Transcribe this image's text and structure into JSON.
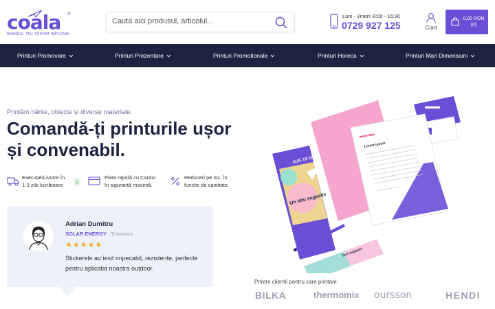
{
  "brand": {
    "name": "coala",
    "registered": "®",
    "tagline": "BRANDUL TĂU, PRINTAT IMPECABIL",
    "accent": "#6a4fd6",
    "dark": "#1d2340"
  },
  "search": {
    "placeholder": "Cauta aici produsul, articolul..."
  },
  "contact": {
    "hours": "Luni - Vineri: 8:00 - 16:30",
    "phone": "0729 927 125"
  },
  "account": {
    "label": "Cont"
  },
  "cart": {
    "total": "0,00 RON",
    "count": "(0)"
  },
  "nav": {
    "items": [
      {
        "label": "Printuri Promovare"
      },
      {
        "label": "Printuri Prezentare"
      },
      {
        "label": "Printuri Promotionale"
      },
      {
        "label": "Printuri Horeca"
      },
      {
        "label": "Printuri Mari Dimensiuni"
      }
    ]
  },
  "hero": {
    "subtitle": "Printăm hârtie, obiecte și diverse materiale.",
    "title": "Comandă-ți printurile ușor și convenabil."
  },
  "features": [
    {
      "icon": "truck-icon",
      "line1": "Execuție/Livrare în",
      "line2": "1-3 zile lucrătoare"
    },
    {
      "icon": "card-icon",
      "line1": "Plata rapidă cu Cardul",
      "line2": "în siguranță maximă."
    },
    {
      "icon": "percent-icon",
      "line1": "Reduceri pe loc, în",
      "line2": "funcție de cantitate."
    }
  ],
  "review": {
    "name": "Adrian Dumitru",
    "company": "SOLAR ENERGY",
    "city": "Timisoara",
    "stars": "★★★★★",
    "rating": 5,
    "text": "Stickerele au iesit impecabil, rezistente, perfecte pentru aplicatia noastra outdoor."
  },
  "mockup": {
    "brochure_title": "Un titlu sugestiv",
    "brochure_date": "AUG 10-12",
    "letter_heading": "Lorem ipsum",
    "card_text": "Text sugestiv"
  },
  "clients": {
    "label": "Printre clientii pentru care printam",
    "logos": [
      "BILKA",
      "thermomix",
      "oursson",
      "HENDI"
    ]
  }
}
